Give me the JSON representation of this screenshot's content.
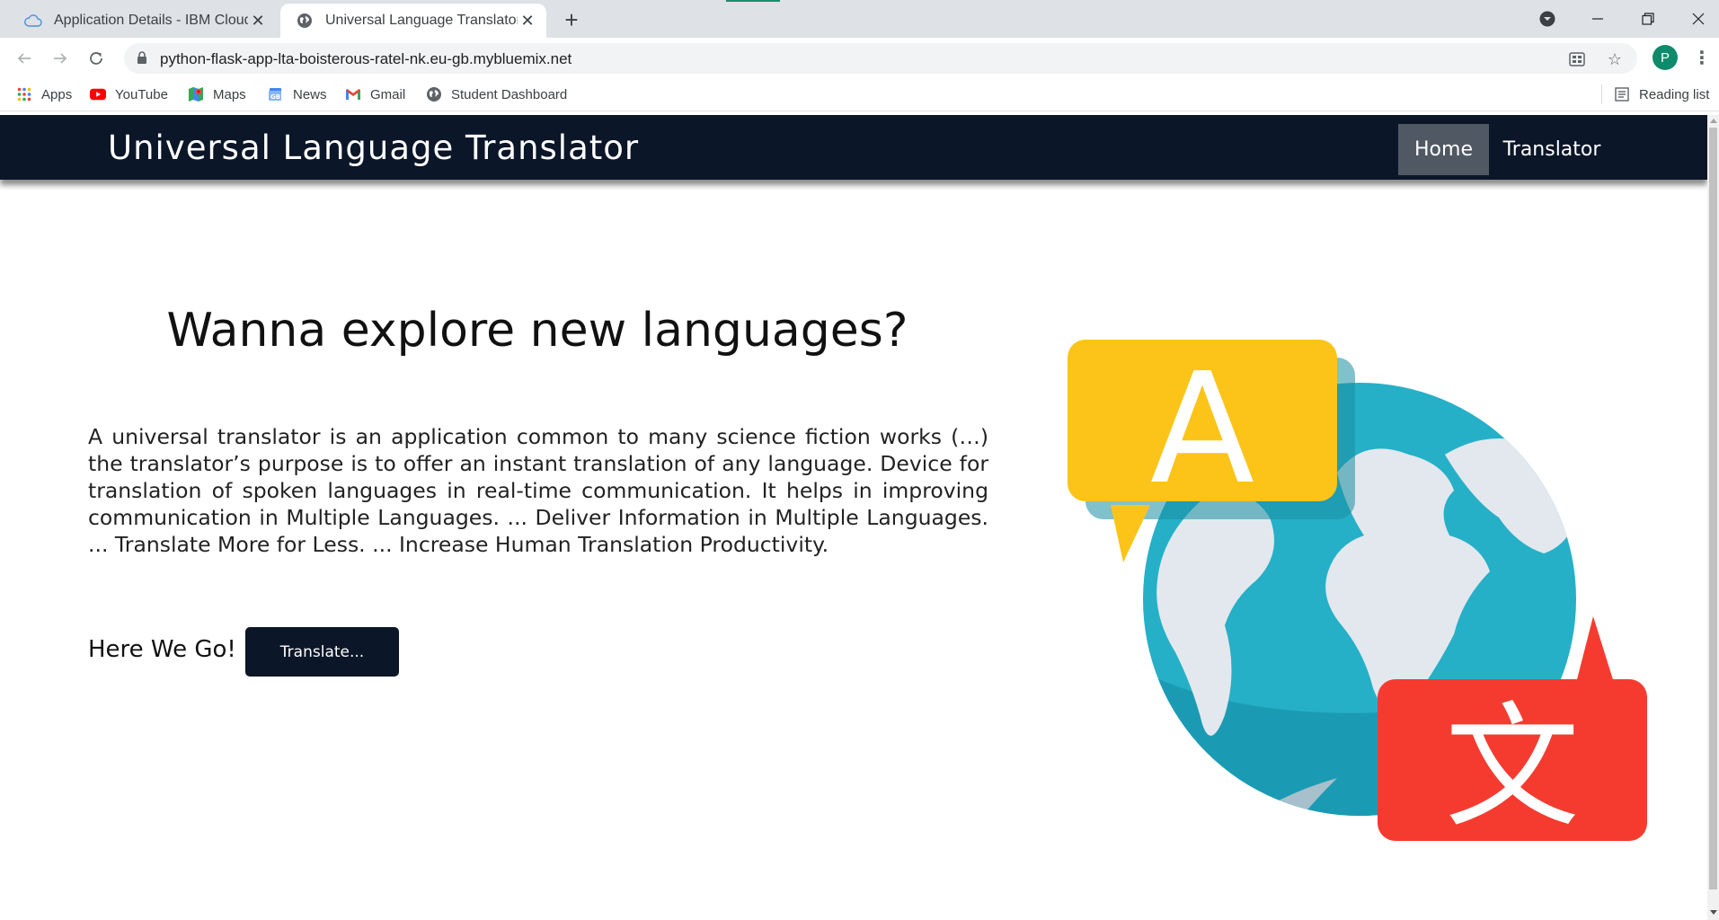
{
  "browser": {
    "tabs": [
      {
        "title": "Application Details - IBM Cloud",
        "active": false
      },
      {
        "title": "Universal Language Translator",
        "active": true
      }
    ],
    "url": "python-flask-app-lta-boisterous-ratel-nk.eu-gb.mybluemix.net",
    "profile_initial": "P",
    "bookmarks": [
      {
        "label": "Apps",
        "icon": "apps-grid-icon"
      },
      {
        "label": "YouTube",
        "icon": "youtube-icon"
      },
      {
        "label": "Maps",
        "icon": "maps-icon"
      },
      {
        "label": "News",
        "icon": "news-icon"
      },
      {
        "label": "Gmail",
        "icon": "gmail-icon"
      },
      {
        "label": "Student Dashboard",
        "icon": "globe-icon"
      }
    ],
    "reading_list": "Reading list"
  },
  "site": {
    "brand": "Universal Language Translator",
    "nav": {
      "home": "Home",
      "translator": "Translator"
    },
    "hero": {
      "title": "Wanna explore new languages?",
      "text": "A universal translator is an application common to many science fiction works (…) the translator’s purpose is to offer an instant translation of any language. Device for translation of spoken languages in real-time communication. It helps in improving communication in Multiple Languages. ... Deliver Information in Multiple Languages. ... Translate More for Less. ... Increase Human Translation Productivity.",
      "cta_label": "Here We Go!",
      "cta_button": "Translate..."
    },
    "illustration": {
      "bubble_left_glyph": "A",
      "bubble_right_glyph": "文"
    }
  },
  "colors": {
    "navbar": "#0b1628",
    "home_active": "#505863",
    "bubble_yellow": "#fcc419",
    "bubble_red": "#f53b2f",
    "globe_ocean": "#25b0c8"
  }
}
